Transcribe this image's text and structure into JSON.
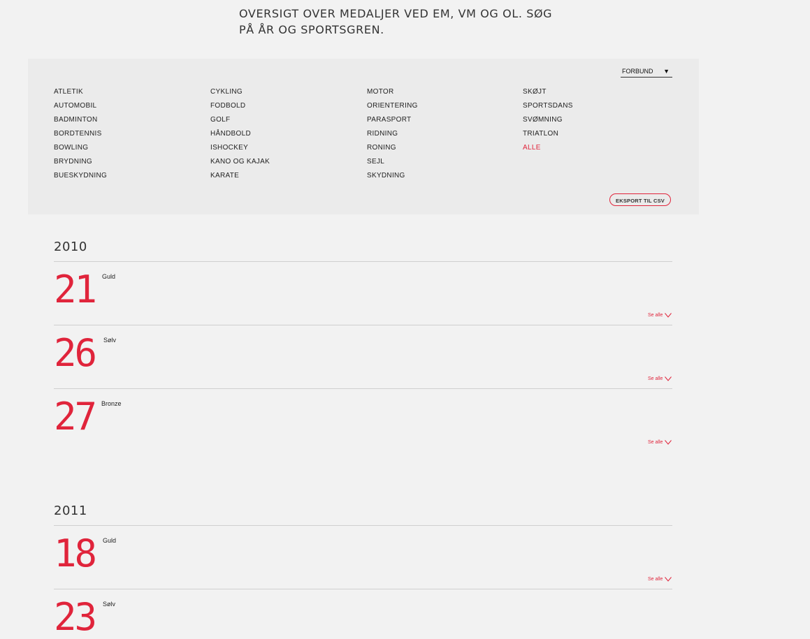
{
  "intro": "OVERSIGT OVER MEDALJER VED EM, VM OG OL. SØG PÅ ÅR OG SPORTSGREN.",
  "filter": {
    "dropdown_label": "FORBUND",
    "dropdown_arrow": "▼",
    "columns": [
      [
        "ATLETIK",
        "AUTOMOBIL",
        "BADMINTON",
        "BORDTENNIS",
        "BOWLING",
        "BRYDNING",
        "BUESKYDNING"
      ],
      [
        "CYKLING",
        "FODBOLD",
        "GOLF",
        "HÅNDBOLD",
        "ISHOCKEY",
        "KANO OG KAJAK",
        "KARATE"
      ],
      [
        "MOTOR",
        "ORIENTERING",
        "PARASPORT",
        "RIDNING",
        "RONING",
        "SEJL",
        "SKYDNING"
      ],
      [
        "SKØJT",
        "SPORTSDANS",
        "SVØMNING",
        "TRIATLON",
        "ALLE"
      ]
    ],
    "active_item": "ALLE",
    "export_label": "EKSPORT TIL CSV"
  },
  "colors": {
    "accent": "#e0243b",
    "background": "#f2f2f2",
    "panel": "#ebebeb"
  },
  "years": [
    {
      "year": "2010",
      "medals": [
        {
          "count": "21",
          "type": "Guld",
          "see_all": "Se alle"
        },
        {
          "count": "26",
          "type": "Sølv",
          "see_all": "Se alle"
        },
        {
          "count": "27",
          "type": "Bronze",
          "see_all": "Se alle"
        }
      ]
    },
    {
      "year": "2011",
      "medals": [
        {
          "count": "18",
          "type": "Guld",
          "see_all": "Se alle"
        },
        {
          "count": "23",
          "type": "Sølv"
        }
      ]
    }
  ]
}
